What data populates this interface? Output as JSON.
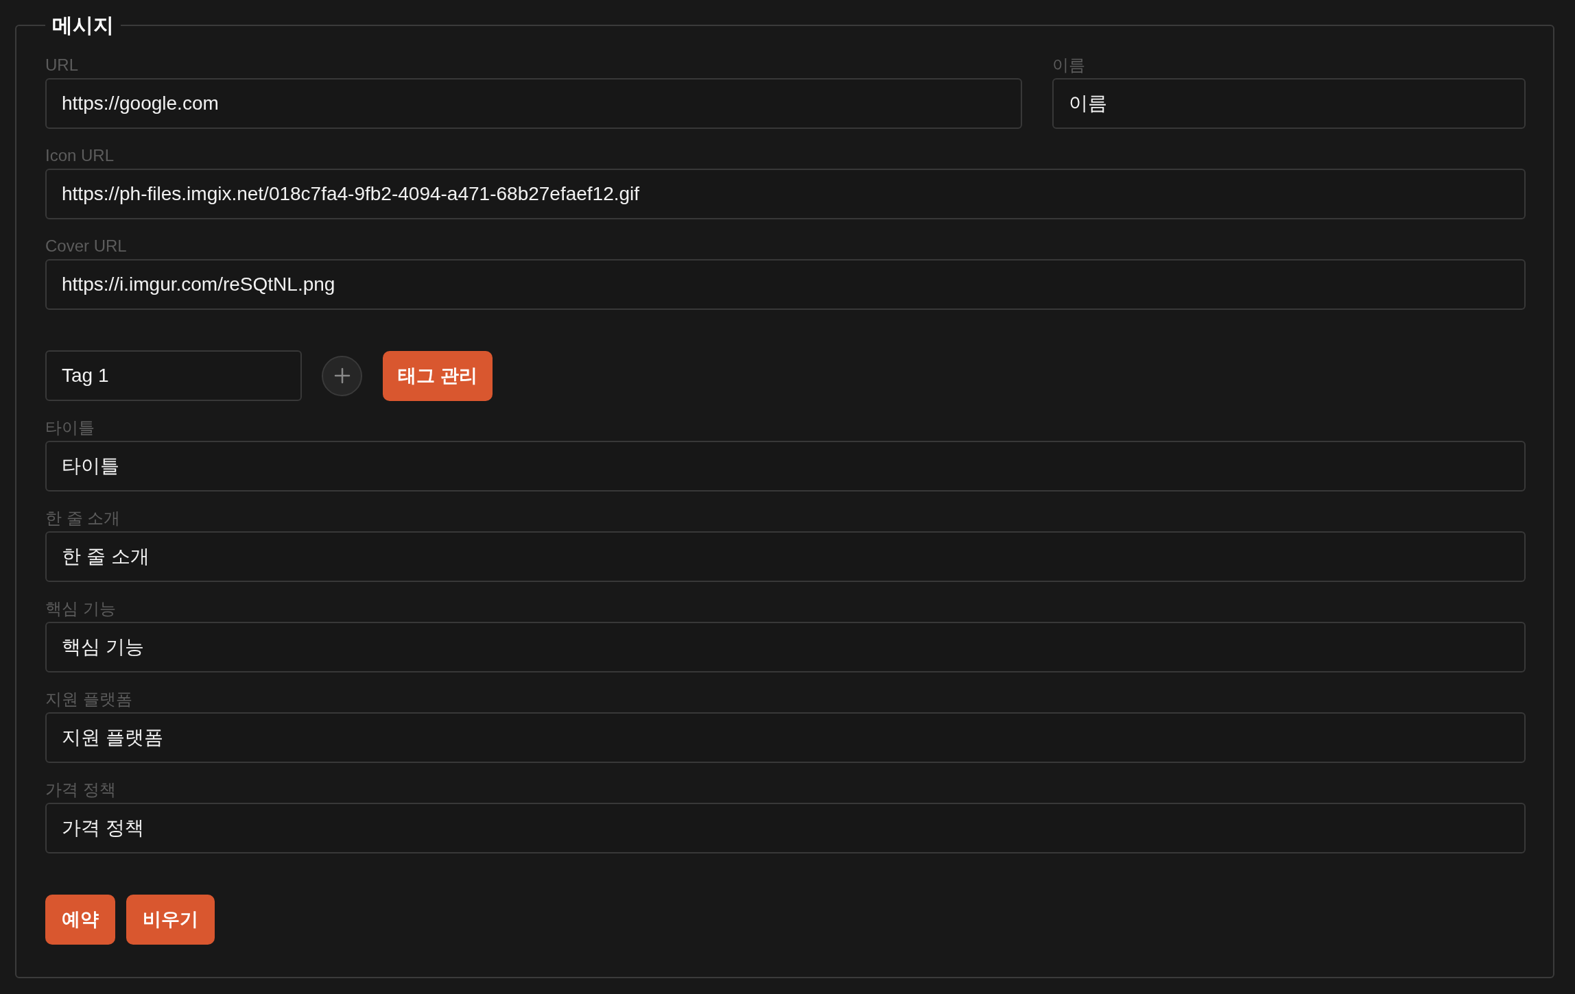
{
  "legend": "메시지",
  "top_row": [
    {
      "label": "URL",
      "value": "https://google.com"
    },
    {
      "label": "이름",
      "value": "이름"
    }
  ],
  "link_fields": [
    {
      "label": "Icon URL",
      "value": "https://ph-files.imgix.net/018c7fa4-9fb2-4094-a471-68b27efaef12.gif"
    },
    {
      "label": "Cover URL",
      "value": "https://i.imgur.com/reSQtNL.png"
    }
  ],
  "tag": {
    "value": "Tag 1",
    "manage_button": "태그 관리"
  },
  "fields": [
    {
      "label": "타이틀",
      "value": "타이틀"
    },
    {
      "label": "한 줄 소개",
      "value": "한 줄 소개"
    },
    {
      "label": "핵심 기능",
      "value": "핵심 기능"
    },
    {
      "label": "지원 플랫폼",
      "value": "지원 플랫폼"
    },
    {
      "label": "가격 정책",
      "value": "가격 정책"
    }
  ],
  "actions": [
    "예약",
    "비우기"
  ]
}
